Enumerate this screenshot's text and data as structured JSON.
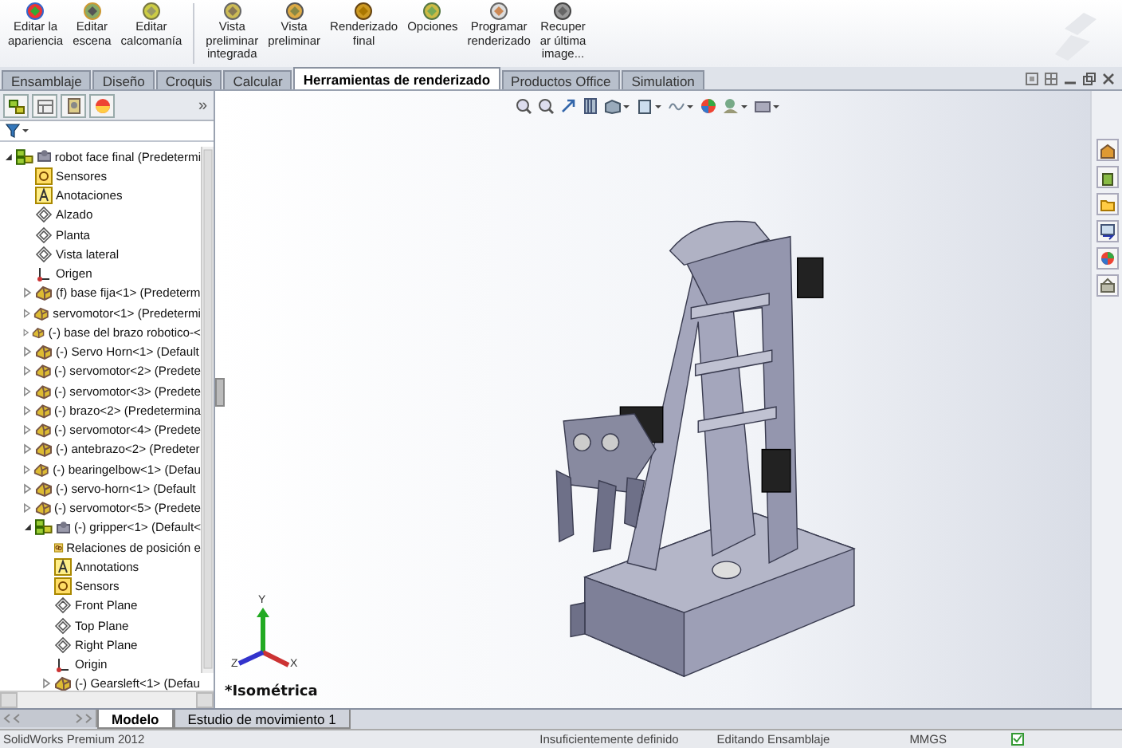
{
  "toolbar": {
    "buttons": [
      {
        "lines": [
          "Editar la",
          "apariencia"
        ]
      },
      {
        "lines": [
          "Editar",
          "escena"
        ]
      },
      {
        "lines": [
          "Editar",
          "calcomanía"
        ]
      },
      {
        "lines": [
          "Vista",
          "preliminar",
          "integrada"
        ]
      },
      {
        "lines": [
          "Vista",
          "preliminar"
        ]
      },
      {
        "lines": [
          "Renderizado",
          "final"
        ]
      },
      {
        "lines": [
          "Opciones"
        ]
      },
      {
        "lines": [
          "Programar",
          "renderizado"
        ]
      },
      {
        "lines": [
          "Recuper",
          "ar última",
          "image..."
        ]
      }
    ]
  },
  "tabs": [
    {
      "label": "Ensamblaje",
      "selected": false
    },
    {
      "label": "Diseño",
      "selected": false
    },
    {
      "label": "Croquis",
      "selected": false
    },
    {
      "label": "Calcular",
      "selected": false
    },
    {
      "label": "Herramientas de renderizado",
      "selected": true
    },
    {
      "label": "Productos Office",
      "selected": false
    },
    {
      "label": "Simulation",
      "selected": false
    }
  ],
  "panel": {
    "more": "»",
    "tree": [
      {
        "kind": "assembly",
        "label": "robot face final  (Predetermi",
        "expanded": true,
        "children": [
          {
            "kind": "sensor",
            "label": "Sensores"
          },
          {
            "kind": "annotation",
            "label": "Anotaciones"
          },
          {
            "kind": "plane",
            "label": "Alzado"
          },
          {
            "kind": "plane",
            "label": "Planta"
          },
          {
            "kind": "plane",
            "label": "Vista lateral"
          },
          {
            "kind": "origin",
            "label": "Origen"
          },
          {
            "kind": "part",
            "label": "(f) base fija<1> (Predeterm",
            "expanded": false
          },
          {
            "kind": "part",
            "label": "servomotor<1> (Predetermi",
            "expanded": false
          },
          {
            "kind": "part",
            "label": "(-) base del brazo robotico-<",
            "expanded": false
          },
          {
            "kind": "part",
            "label": "(-) Servo Horn<1> (Default",
            "expanded": false
          },
          {
            "kind": "part",
            "label": "(-) servomotor<2> (Predete",
            "expanded": false
          },
          {
            "kind": "part",
            "label": "(-) servomotor<3> (Predete",
            "expanded": false
          },
          {
            "kind": "part",
            "label": "(-) brazo<2> (Predetermina",
            "expanded": false
          },
          {
            "kind": "part",
            "label": "(-) servomotor<4> (Predete",
            "expanded": false
          },
          {
            "kind": "part",
            "label": "(-) antebrazo<2> (Predeter",
            "expanded": false
          },
          {
            "kind": "part",
            "label": "(-) bearingelbow<1> (Defau",
            "expanded": false
          },
          {
            "kind": "part",
            "label": "(-) servo-horn<1> (Default",
            "expanded": false
          },
          {
            "kind": "part",
            "label": "(-) servomotor<5> (Predete",
            "expanded": false
          },
          {
            "kind": "assembly",
            "label": "(-) gripper<1> (Default<",
            "expanded": true,
            "children": [
              {
                "kind": "mates",
                "label": "Relaciones de posición e"
              },
              {
                "kind": "annotation",
                "label": "Annotations"
              },
              {
                "kind": "sensor",
                "label": "Sensors"
              },
              {
                "kind": "plane",
                "label": "Front Plane"
              },
              {
                "kind": "plane",
                "label": "Top Plane"
              },
              {
                "kind": "plane",
                "label": "Right Plane"
              },
              {
                "kind": "origin",
                "label": "Origin"
              },
              {
                "kind": "part",
                "label": "(-) Gearsleft<1> (Defau",
                "expanded": false
              }
            ]
          }
        ]
      }
    ]
  },
  "viewport": {
    "view_label": "*Isométrica",
    "axes": {
      "x": "X",
      "y": "Y",
      "z": "Z"
    }
  },
  "bottom_tabs": [
    {
      "label": "Modelo",
      "selected": true
    },
    {
      "label": "Estudio de movimiento 1",
      "selected": false
    }
  ],
  "status_bar": {
    "product": "SolidWorks Premium 2012",
    "definition": "Insuficientemente definido",
    "mode": "Editando Ensamblaje",
    "units": "MMGS"
  }
}
